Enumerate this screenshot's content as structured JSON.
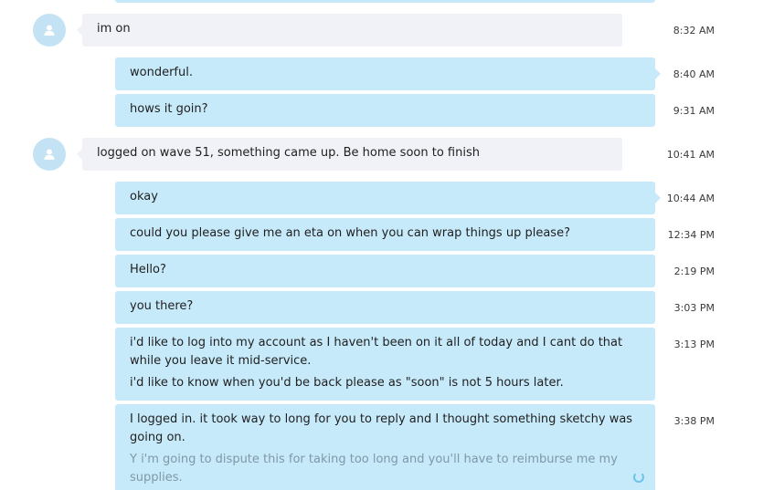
{
  "messages": [
    {
      "text": "im on",
      "time": "8:32 AM"
    },
    {
      "text": "wonderful.",
      "time": "8:40 AM"
    },
    {
      "text": "hows it goin?",
      "time": "9:31 AM"
    },
    {
      "text": "logged on wave 51, something came up. Be home soon to finish",
      "time": "10:41 AM"
    },
    {
      "text": "okay",
      "time": "10:44 AM"
    },
    {
      "text": "could you please give me an eta on when you can wrap things up please?",
      "time": "12:34 PM"
    },
    {
      "text": "Hello?",
      "time": "2:19 PM"
    },
    {
      "text": "you there?",
      "time": "3:03 PM"
    },
    {
      "text": "i'd like to log into my account as I haven't been on it all of today and I cant do that while you leave it mid-service.",
      "text2": "i'd like to know when you'd be back please as \"soon\" is not 5 hours later.",
      "time": "3:13 PM"
    },
    {
      "text": "I logged in. it took way to long for you to reply and I thought something sketchy was going on.",
      "text2": "Y i'm going to dispute this for taking too long and you'll have to reimburse me my supplies.",
      "time": "3:38 PM"
    }
  ],
  "icons": {
    "avatar": "user-silhouette-icon",
    "sending": "loading-spinner-icon"
  },
  "colors": {
    "incoming_bubble": "#f1f2f7",
    "outgoing_bubble": "#c7eafa",
    "avatar_bg": "#c3e3f5",
    "pending_text": "#7f98a6",
    "spinner": "#6cc3ec"
  }
}
